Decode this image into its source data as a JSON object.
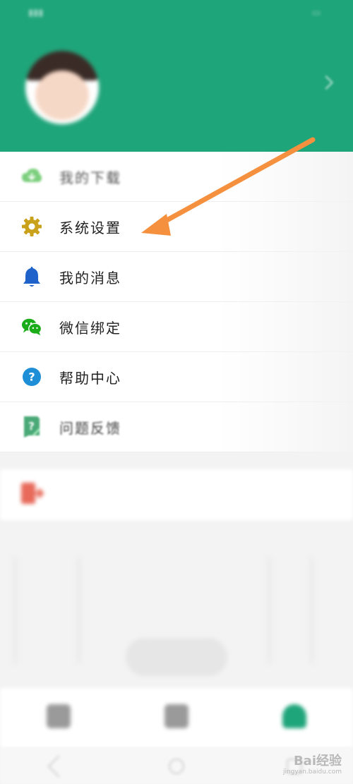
{
  "status_bar": {
    "left": "",
    "right": ""
  },
  "profile": {
    "name_line": "",
    "account_line": "",
    "school_line": ""
  },
  "menu": {
    "items": [
      {
        "label": "我的下载",
        "icon": "cloud-download-icon",
        "color": "#7ccf7e"
      },
      {
        "label": "系统设置",
        "icon": "gear-icon",
        "color": "#c9a11a"
      },
      {
        "label": "我的消息",
        "icon": "bell-icon",
        "color": "#1f62c9"
      },
      {
        "label": "微信绑定",
        "icon": "wechat-icon",
        "color": "#1aad19"
      },
      {
        "label": "帮助中心",
        "icon": "help-circle-icon",
        "color": "#1e8fd6"
      },
      {
        "label": "问题反馈",
        "icon": "feedback-icon",
        "color": "#2b9b60"
      }
    ]
  },
  "logout": {
    "label": "",
    "icon": "logout-icon",
    "color": "#e86a5a"
  },
  "toast": {
    "text": ""
  },
  "bottom_nav": {
    "items": [
      {
        "label": "",
        "icon": "home-icon",
        "active": false
      },
      {
        "label": "",
        "icon": "grid-icon",
        "active": false
      },
      {
        "label": "",
        "icon": "person-icon",
        "active": true
      }
    ]
  },
  "watermark": {
    "main": "Bai经验",
    "sub": "jingyan.baidu.com"
  },
  "colors": {
    "header": "#1fa57a",
    "arrow": "#f5913e"
  }
}
